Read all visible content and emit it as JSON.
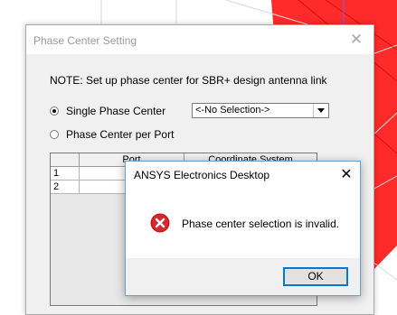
{
  "phase_center_dialog": {
    "title": "Phase Center Setting",
    "close_glyph": "✕",
    "note": "NOTE: Set up phase center for SBR+ design antenna link",
    "single_phase_center_label": "Single Phase Center",
    "single_phase_center_selected": true,
    "selection_value": "<-No Selection->",
    "per_port_label": "Phase Center per Port",
    "per_port_selected": false,
    "grid": {
      "columns": [
        "Port",
        "Coordinate System"
      ],
      "rows": [
        {
          "num": "1",
          "port": "",
          "coord": ""
        },
        {
          "num": "2",
          "port": "",
          "coord": ""
        }
      ]
    }
  },
  "error_box": {
    "title": "ANSYS Electronics Desktop",
    "close_glyph": "✕",
    "icon": "error-icon",
    "message": "Phase center selection is invalid.",
    "ok_label": "OK"
  },
  "colors": {
    "model_red": "#ff2a2a",
    "error_red": "#c8181e",
    "accent_blue": "#0078d7"
  }
}
